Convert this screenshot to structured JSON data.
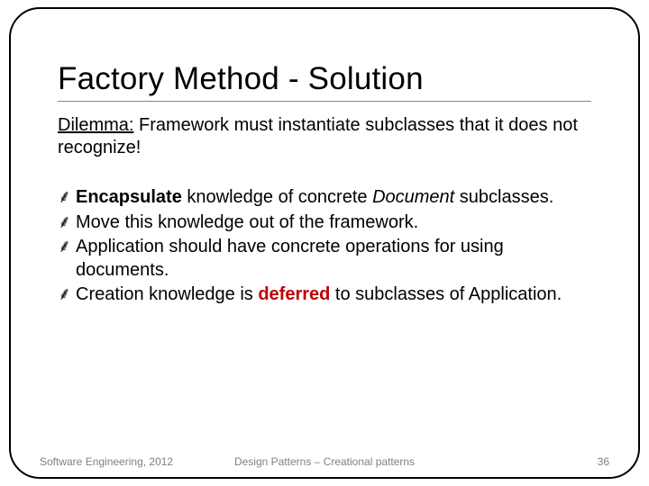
{
  "title": "Factory Method - Solution",
  "dilemma": {
    "lead": "Dilemma:",
    "rest": " Framework must instantiate subclasses that it does not recognize!"
  },
  "bullets": [
    {
      "pre": "Encapsulate",
      "mid": " knowledge of concrete ",
      "ital": "Document",
      "post": " subclasses."
    },
    {
      "text": "Move this knowledge out of the framework."
    },
    {
      "text": "Application should have concrete operations for using documents."
    },
    {
      "pre2": "Creation knowledge is ",
      "def": "deferred",
      "post2": " to subclasses of Application."
    }
  ],
  "footer": {
    "left": "Software Engineering, 2012",
    "center": "Design Patterns – Creational patterns",
    "right": "36"
  },
  "marker": "⸙"
}
